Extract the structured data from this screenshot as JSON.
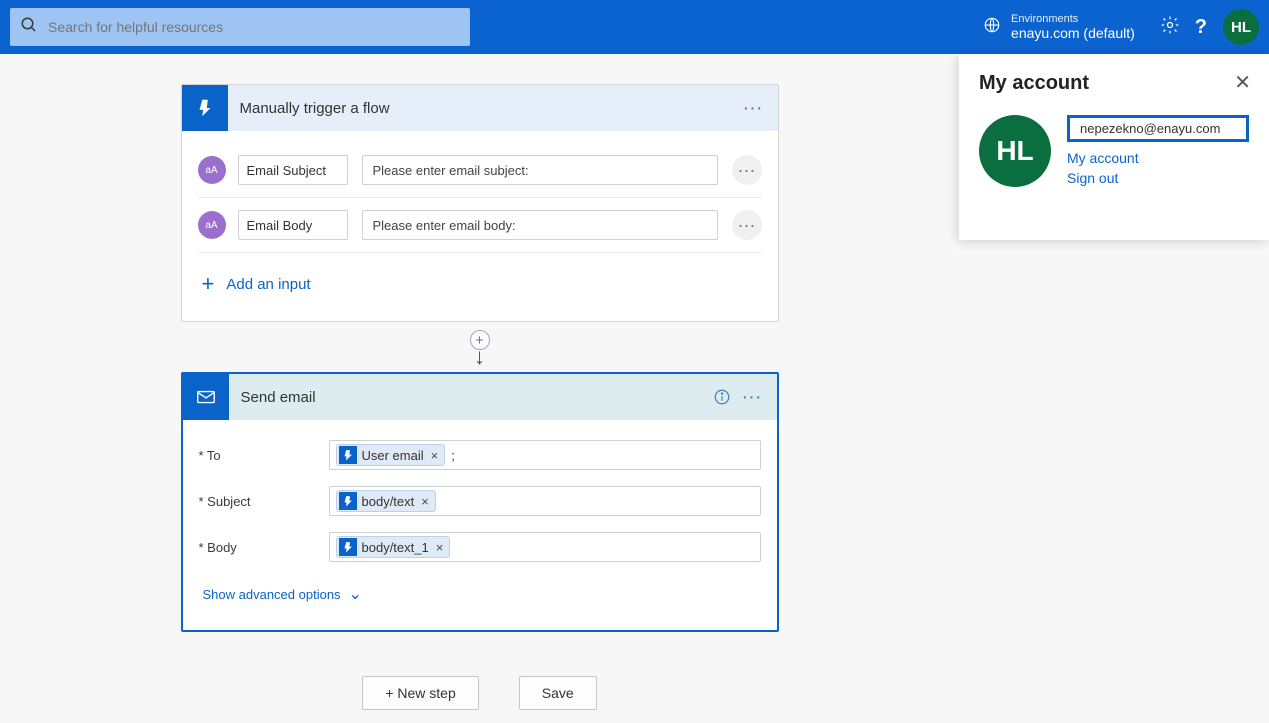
{
  "topbar": {
    "search_placeholder": "Search for helpful resources",
    "env_label": "Environments",
    "env_value": "enayu.com (default)",
    "avatar_initials": "HL"
  },
  "trigger": {
    "title": "Manually trigger a flow",
    "params": [
      {
        "icon": "aA",
        "label": "Email Subject",
        "placeholder": "Please enter email subject:"
      },
      {
        "icon": "aA",
        "label": "Email Body",
        "placeholder": "Please enter email body:"
      }
    ],
    "add_input": "Add an input"
  },
  "action": {
    "title": "Send email",
    "fields": [
      {
        "label": "* To",
        "token": "User email",
        "suffix": ";"
      },
      {
        "label": "* Subject",
        "token": "body/text",
        "suffix": ""
      },
      {
        "label": "* Body",
        "token": "body/text_1",
        "suffix": ""
      }
    ],
    "advanced": "Show advanced options"
  },
  "footer": {
    "new_step": "+ New step",
    "save": "Save"
  },
  "account_panel": {
    "title": "My account",
    "avatar_initials": "HL",
    "email": "nepezekno@enayu.com",
    "link_account": "My account",
    "link_signout": "Sign out"
  }
}
